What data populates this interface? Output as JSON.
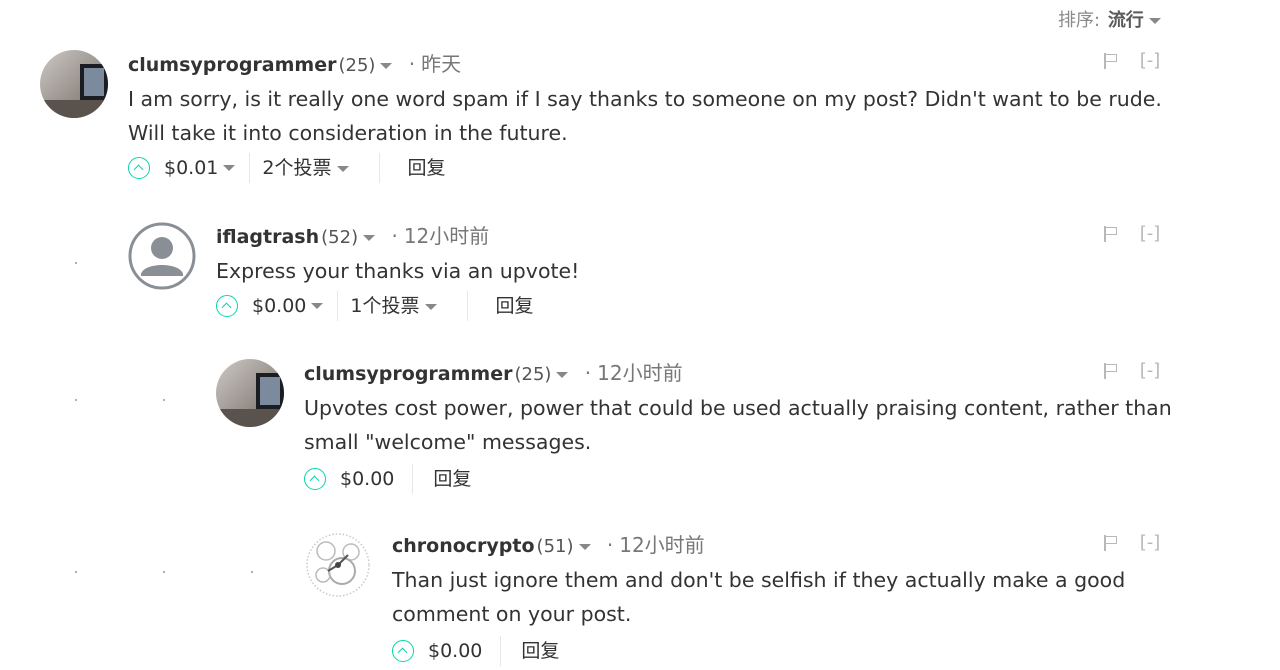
{
  "sort": {
    "label": "排序:",
    "value": "流行"
  },
  "comments": [
    {
      "author": "clumsyprogrammer",
      "rep": "(25)",
      "time": "昨天",
      "text": "I am sorry, is it really one word spam if I say thanks to someone on my post? Didn't want to be rude. Will take it into consideration in the future.",
      "payout": "$0.01",
      "votes": "2个投票",
      "reply": "回复",
      "collapse": "[-]"
    },
    {
      "author": "iflagtrash",
      "rep": "(52)",
      "time": "12小时前",
      "text": "Express your thanks via an upvote!",
      "payout": "$0.00",
      "votes": "1个投票",
      "reply": "回复",
      "collapse": "[-]"
    },
    {
      "author": "clumsyprogrammer",
      "rep": "(25)",
      "time": "12小时前",
      "text": "Upvotes cost power, power that could be used actually praising content, rather than small \"welcome\" messages.",
      "payout": "$0.00",
      "reply": "回复",
      "collapse": "[-]"
    },
    {
      "author": "chronocrypto",
      "rep": "(51)",
      "time": "12小时前",
      "text": "Than just ignore them and don't be selfish if they actually make a good comment on your post.",
      "payout": "$0.00",
      "reply": "回复",
      "collapse": "[-]"
    }
  ],
  "colors": {
    "accent": "#06d6a9",
    "muted": "#b8b8b8"
  },
  "icons": [
    "caret-down-icon",
    "upvote-icon",
    "flag-icon",
    "default-avatar-icon"
  ]
}
